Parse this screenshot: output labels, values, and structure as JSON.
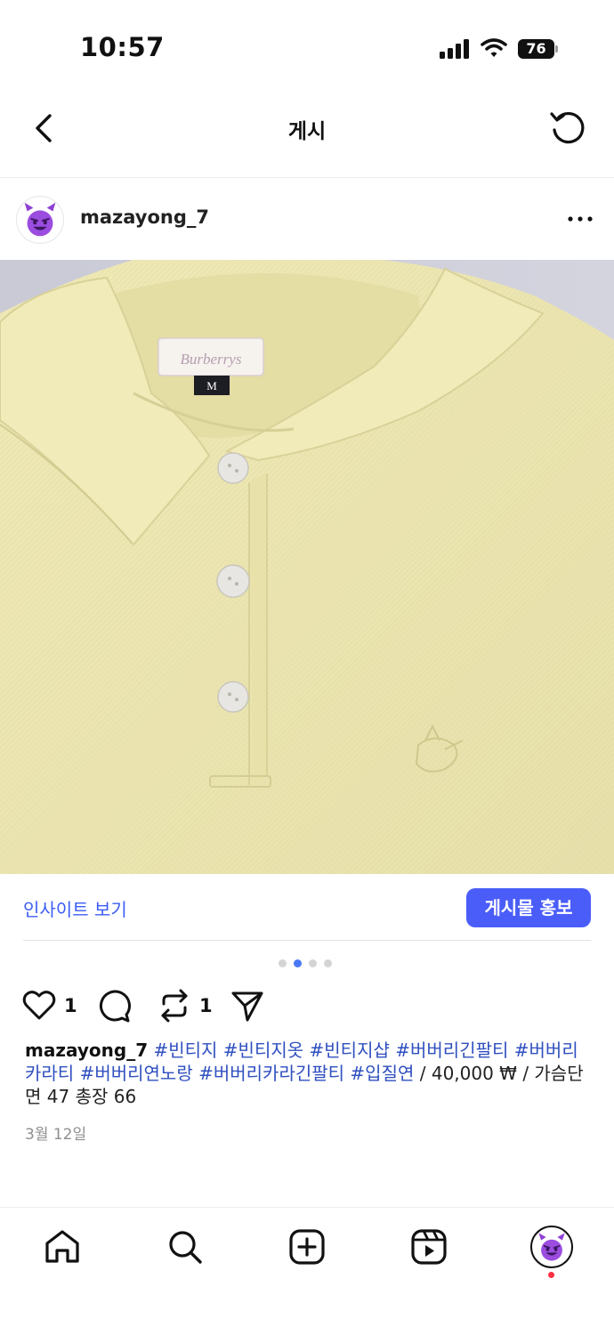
{
  "status_bar": {
    "time": "10:57",
    "battery": "76"
  },
  "header": {
    "title": "게시",
    "back_icon": "chevron-left-icon",
    "refresh_icon": "refresh-icon"
  },
  "post": {
    "username": "mazayong_7",
    "avatar_icon": "smiling-devil-emoji",
    "more_icon": "more-horizontal-icon",
    "image": {
      "label_text": "Burberrys",
      "size_tag": "M",
      "shirt_color": "#ece6b3",
      "background_color": "#cfd0dc"
    },
    "insights_label": "인사이트 보기",
    "promote_label": "게시물 홍보",
    "carousel": {
      "total": 4,
      "active_index": 1
    },
    "actions": {
      "like_count": "1",
      "repost_count": "1"
    },
    "caption": {
      "username": "mazayong_7",
      "hashtags": [
        "#빈티지",
        "#빈티지옷",
        "#빈티지샵",
        "#버버리긴팔티",
        "#버버리카라티",
        "#버버리연노랑",
        "#버버리카라긴팔티",
        "#입질연"
      ],
      "text": "/ 40,000 ₩ / 가슴단면 47 총장 66"
    },
    "date": "3월 12일"
  },
  "tab_bar": {
    "items": [
      "home-icon",
      "search-icon",
      "create-icon",
      "reels-icon",
      "profile-avatar"
    ]
  },
  "colors": {
    "accent": "#4a5df9",
    "link": "#3b5cf5",
    "hashtag": "#2f4fbf",
    "notification": "#ff3040"
  }
}
